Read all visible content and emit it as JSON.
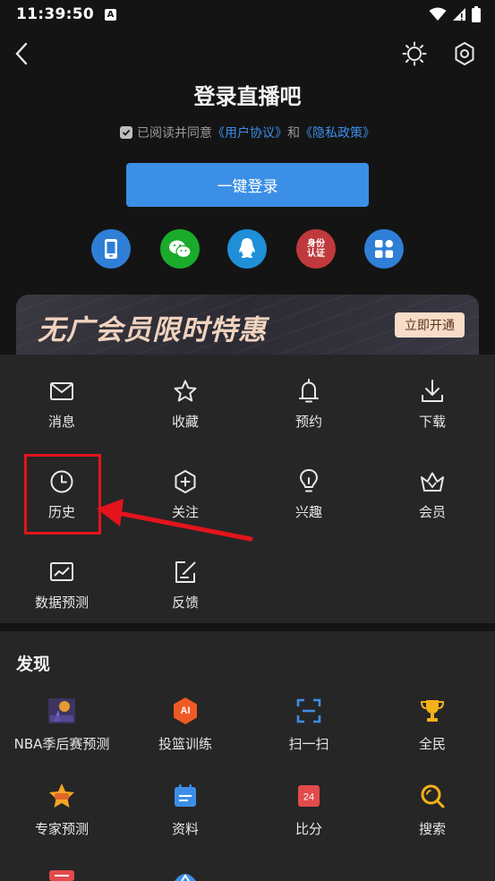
{
  "status_bar": {
    "time": "11:39:50",
    "badge": "A"
  },
  "header": {
    "title": "登录直播吧"
  },
  "agreement": {
    "prefix": "已阅读并同意",
    "user_agreement": "《用户协议》",
    "and": "和",
    "privacy_policy": "《隐私政策》"
  },
  "login": {
    "button_label": "一键登录"
  },
  "login_methods": [
    {
      "name": "phone",
      "color": "#2f7fd7"
    },
    {
      "name": "wechat",
      "color": "#1aab2b"
    },
    {
      "name": "qq",
      "color": "#1f8fd8"
    },
    {
      "name": "identity",
      "color": "#c0393d",
      "text_line1": "身份",
      "text_line2": "认证"
    },
    {
      "name": "more",
      "color": "#2f7fd7"
    }
  ],
  "vip_banner": {
    "text": "无广会员限时特惠",
    "button": "立即开通"
  },
  "menu": {
    "items": [
      {
        "label": "消息",
        "icon": "mail-icon"
      },
      {
        "label": "收藏",
        "icon": "star-icon"
      },
      {
        "label": "预约",
        "icon": "bell-icon"
      },
      {
        "label": "下载",
        "icon": "download-icon"
      },
      {
        "label": "历史",
        "icon": "clock-icon"
      },
      {
        "label": "关注",
        "icon": "hexagon-plus-icon"
      },
      {
        "label": "兴趣",
        "icon": "bulb-icon"
      },
      {
        "label": "会员",
        "icon": "crown-icon"
      },
      {
        "label": "数据预测",
        "icon": "chart-icon"
      },
      {
        "label": "反馈",
        "icon": "edit-icon"
      }
    ]
  },
  "discover": {
    "title": "发现",
    "items": [
      {
        "label": "NBA季后赛预测",
        "icon": "nba-playoff-icon"
      },
      {
        "label": "投篮训练",
        "icon": "ai-shoot-icon",
        "badge_text": "AI"
      },
      {
        "label": "扫一扫",
        "icon": "scan-icon"
      },
      {
        "label": "全民",
        "icon": "trophy-icon"
      },
      {
        "label": "专家预测",
        "icon": "expert-star-icon"
      },
      {
        "label": "资料",
        "icon": "calendar-icon"
      },
      {
        "label": "比分",
        "icon": "score-icon",
        "badge_text": "24"
      },
      {
        "label": "搜索",
        "icon": "search-icon"
      }
    ]
  },
  "colors": {
    "accent": "#3c8fe6",
    "highlight": "#e3141c",
    "vip_gold": "#f0d3bf"
  }
}
